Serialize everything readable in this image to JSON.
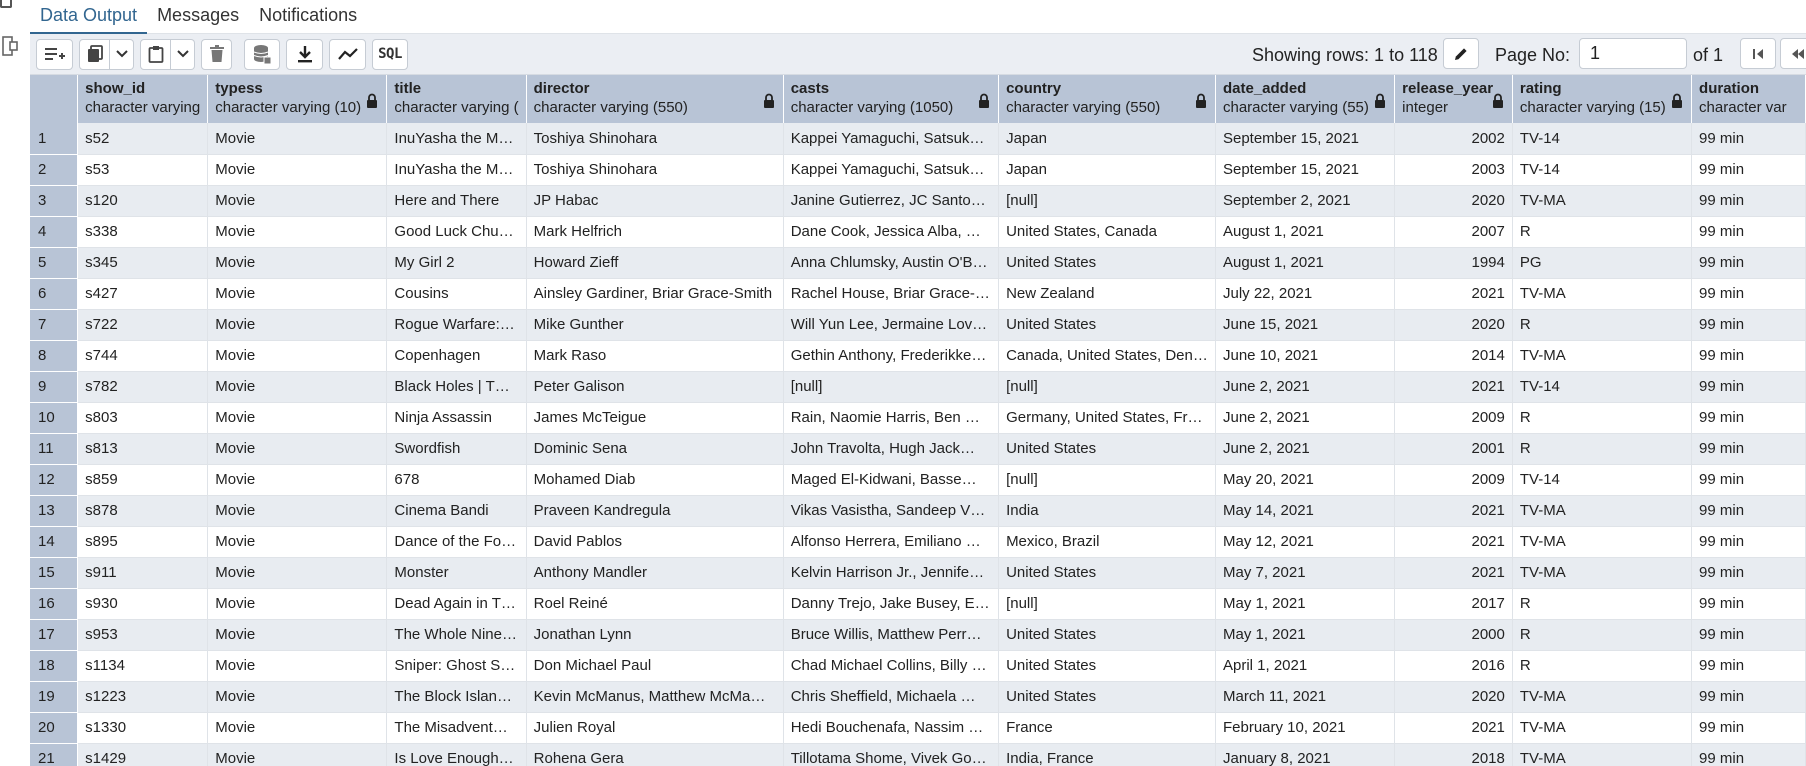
{
  "tabs": [
    "Data Output",
    "Messages",
    "Notifications"
  ],
  "active_tab": "Data Output",
  "toolbar": {
    "rows_info": "Showing rows: 1 to 118",
    "page_label": "Page No:",
    "page_value": "1",
    "of_label": "of 1",
    "sql_label": "SQL"
  },
  "columns": [
    {
      "name": "show_id",
      "type": "character varying",
      "locked": false
    },
    {
      "name": "typess",
      "type": "character varying (10)",
      "locked": true
    },
    {
      "name": "title",
      "type": "character varying (",
      "locked": false
    },
    {
      "name": "director",
      "type": "character varying (550)",
      "locked": true
    },
    {
      "name": "casts",
      "type": "character varying (1050)",
      "locked": true
    },
    {
      "name": "country",
      "type": "character varying (550)",
      "locked": true
    },
    {
      "name": "date_added",
      "type": "character varying (55)",
      "locked": true
    },
    {
      "name": "release_year",
      "type": "integer",
      "locked": true
    },
    {
      "name": "rating",
      "type": "character varying (15)",
      "locked": true
    },
    {
      "name": "duration",
      "type": "character var",
      "locked": false
    }
  ],
  "rows": [
    [
      "1",
      "s52",
      "Movie",
      "InuYasha the M…",
      "Toshiya Shinohara",
      "Kappei Yamaguchi, Satsuk…",
      "Japan",
      "September 15, 2021",
      "2002",
      "TV-14",
      "99 min"
    ],
    [
      "2",
      "s53",
      "Movie",
      "InuYasha the M…",
      "Toshiya Shinohara",
      "Kappei Yamaguchi, Satsuk…",
      "Japan",
      "September 15, 2021",
      "2003",
      "TV-14",
      "99 min"
    ],
    [
      "3",
      "s120",
      "Movie",
      "Here and There",
      "JP Habac",
      "Janine Gutierrez, JC Santo…",
      "[null]",
      "September 2, 2021",
      "2020",
      "TV-MA",
      "99 min"
    ],
    [
      "4",
      "s338",
      "Movie",
      "Good Luck Chu…",
      "Mark Helfrich",
      "Dane Cook, Jessica Alba, …",
      "United States, Canada",
      "August 1, 2021",
      "2007",
      "R",
      "99 min"
    ],
    [
      "5",
      "s345",
      "Movie",
      "My Girl 2",
      "Howard Zieff",
      "Anna Chlumsky, Austin O'B…",
      "United States",
      "August 1, 2021",
      "1994",
      "PG",
      "99 min"
    ],
    [
      "6",
      "s427",
      "Movie",
      "Cousins",
      "Ainsley Gardiner, Briar Grace-Smith",
      "Rachel House, Briar Grace-…",
      "New Zealand",
      "July 22, 2021",
      "2021",
      "TV-MA",
      "99 min"
    ],
    [
      "7",
      "s722",
      "Movie",
      "Rogue Warfare:…",
      "Mike Gunther",
      "Will Yun Lee, Jermaine Lov…",
      "United States",
      "June 15, 2021",
      "2020",
      "R",
      "99 min"
    ],
    [
      "8",
      "s744",
      "Movie",
      "Copenhagen",
      "Mark Raso",
      "Gethin Anthony, Frederikke…",
      "Canada, United States, Den…",
      "June 10, 2021",
      "2014",
      "TV-MA",
      "99 min"
    ],
    [
      "9",
      "s782",
      "Movie",
      "Black Holes | T…",
      "Peter Galison",
      "[null]",
      "[null]",
      "June 2, 2021",
      "2021",
      "TV-14",
      "99 min"
    ],
    [
      "10",
      "s803",
      "Movie",
      "Ninja Assassin",
      "James McTeigue",
      "Rain, Naomie Harris, Ben …",
      "Germany, United States, Fr…",
      "June 2, 2021",
      "2009",
      "R",
      "99 min"
    ],
    [
      "11",
      "s813",
      "Movie",
      "Swordfish",
      "Dominic Sena",
      "John Travolta, Hugh Jack…",
      "United States",
      "June 2, 2021",
      "2001",
      "R",
      "99 min"
    ],
    [
      "12",
      "s859",
      "Movie",
      "678",
      "Mohamed Diab",
      "Maged El-Kidwani, Basse…",
      "[null]",
      "May 20, 2021",
      "2009",
      "TV-14",
      "99 min"
    ],
    [
      "13",
      "s878",
      "Movie",
      "Cinema Bandi",
      "Praveen Kandregula",
      "Vikas Vasistha, Sandeep V…",
      "India",
      "May 14, 2021",
      "2021",
      "TV-MA",
      "99 min"
    ],
    [
      "14",
      "s895",
      "Movie",
      "Dance of the Fo…",
      "David Pablos",
      "Alfonso Herrera, Emiliano …",
      "Mexico, Brazil",
      "May 12, 2021",
      "2021",
      "TV-MA",
      "99 min"
    ],
    [
      "15",
      "s911",
      "Movie",
      "Monster",
      "Anthony Mandler",
      "Kelvin Harrison Jr., Jennife…",
      "United States",
      "May 7, 2021",
      "2021",
      "TV-MA",
      "99 min"
    ],
    [
      "16",
      "s930",
      "Movie",
      "Dead Again in T…",
      "Roel Reiné",
      "Danny Trejo, Jake Busey, E…",
      "[null]",
      "May 1, 2021",
      "2017",
      "R",
      "99 min"
    ],
    [
      "17",
      "s953",
      "Movie",
      "The Whole Nine…",
      "Jonathan Lynn",
      "Bruce Willis, Matthew Perr…",
      "United States",
      "May 1, 2021",
      "2000",
      "R",
      "99 min"
    ],
    [
      "18",
      "s1134",
      "Movie",
      "Sniper: Ghost S…",
      "Don Michael Paul",
      "Chad Michael Collins, Billy …",
      "United States",
      "April 1, 2021",
      "2016",
      "R",
      "99 min"
    ],
    [
      "19",
      "s1223",
      "Movie",
      "The Block Islan…",
      "Kevin McManus, Matthew McMa…",
      "Chris Sheffield, Michaela …",
      "United States",
      "March 11, 2021",
      "2020",
      "TV-MA",
      "99 min"
    ],
    [
      "20",
      "s1330",
      "Movie",
      "The Misadvent…",
      "Julien Royal",
      "Hedi Bouchenafa, Nassim …",
      "France",
      "February 10, 2021",
      "2021",
      "TV-MA",
      "99 min"
    ],
    [
      "21",
      "s1429",
      "Movie",
      "Is Love Enough…",
      "Rohena Gera",
      "Tillotama Shome, Vivek Go…",
      "India, France",
      "January 8, 2021",
      "2018",
      "TV-MA",
      "99 min"
    ]
  ]
}
